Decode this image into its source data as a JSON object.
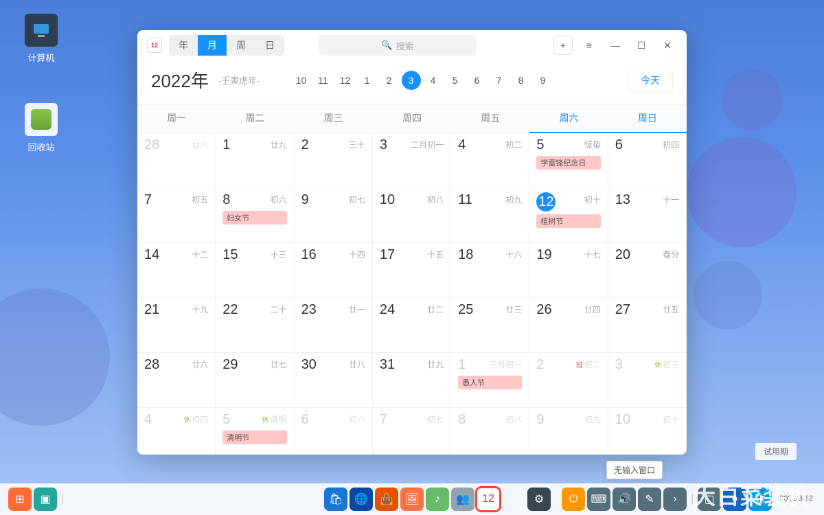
{
  "desktop": {
    "computer": "计算机",
    "trash": "回收站"
  },
  "window": {
    "appIconText": "12",
    "views": {
      "year": "年",
      "month": "月",
      "week": "周",
      "day": "日",
      "active": "月"
    },
    "searchPlaceholder": "搜索",
    "yearTitle": "2022年",
    "yearSub": "-壬寅虎年-",
    "monthValues": [
      "10",
      "11",
      "12",
      "1",
      "2",
      "3",
      "4",
      "5",
      "6",
      "7",
      "8",
      "9"
    ],
    "currentMonth": "3",
    "todayLabel": "今天",
    "weekdays": [
      "周一",
      "周二",
      "周三",
      "周四",
      "周五",
      "周六",
      "周日"
    ]
  },
  "cells": [
    [
      {
        "d": "28",
        "l": "廿八",
        "dim": true
      },
      {
        "d": "1",
        "l": "廿九"
      },
      {
        "d": "2",
        "l": "三十"
      },
      {
        "d": "3",
        "l": "二月初一"
      },
      {
        "d": "4",
        "l": "初二"
      },
      {
        "d": "5",
        "l": "惊蛰",
        "ev": "学雷锋纪念日"
      },
      {
        "d": "6",
        "l": "初四"
      }
    ],
    [
      {
        "d": "7",
        "l": "初五"
      },
      {
        "d": "8",
        "l": "初六",
        "ev": "妇女节"
      },
      {
        "d": "9",
        "l": "初七"
      },
      {
        "d": "10",
        "l": "初八"
      },
      {
        "d": "11",
        "l": "初九"
      },
      {
        "d": "12",
        "l": "初十",
        "today": true,
        "ev": "植树节"
      },
      {
        "d": "13",
        "l": "十一"
      }
    ],
    [
      {
        "d": "14",
        "l": "十二"
      },
      {
        "d": "15",
        "l": "十三"
      },
      {
        "d": "16",
        "l": "十四"
      },
      {
        "d": "17",
        "l": "十五"
      },
      {
        "d": "18",
        "l": "十六"
      },
      {
        "d": "19",
        "l": "十七"
      },
      {
        "d": "20",
        "l": "春分"
      }
    ],
    [
      {
        "d": "21",
        "l": "十九"
      },
      {
        "d": "22",
        "l": "二十"
      },
      {
        "d": "23",
        "l": "廿一"
      },
      {
        "d": "24",
        "l": "廿二"
      },
      {
        "d": "25",
        "l": "廿三"
      },
      {
        "d": "26",
        "l": "廿四"
      },
      {
        "d": "27",
        "l": "廿五"
      }
    ],
    [
      {
        "d": "28",
        "l": "廿六"
      },
      {
        "d": "29",
        "l": "廿七"
      },
      {
        "d": "30",
        "l": "廿八"
      },
      {
        "d": "31",
        "l": "廿九"
      },
      {
        "d": "1",
        "l": "三月初一",
        "dim": true,
        "ev": "愚人节"
      },
      {
        "d": "2",
        "l": "初二",
        "dim": true,
        "dot": "red"
      },
      {
        "d": "3",
        "l": "初三",
        "dim": true,
        "dot": "green"
      }
    ],
    [
      {
        "d": "4",
        "l": "初四",
        "dim": true,
        "dot": "green"
      },
      {
        "d": "5",
        "l": "清明",
        "dim": true,
        "ev": "清明节",
        "dot": "green"
      },
      {
        "d": "6",
        "l": "初六",
        "dim": true
      },
      {
        "d": "7",
        "l": "初七",
        "dim": true
      },
      {
        "d": "8",
        "l": "初八",
        "dim": true
      },
      {
        "d": "9",
        "l": "初九",
        "dim": true
      },
      {
        "d": "10",
        "l": "初十",
        "dim": true
      }
    ]
  ],
  "tooltip": "无输入窗口",
  "trial": "试用期",
  "taskbarDate": "2022/3/12",
  "watermark": "大白菜装机",
  "dockIcons": [
    {
      "name": "launcher-icon",
      "bg": "#ff6b35",
      "g": "⊞"
    },
    {
      "name": "file-manager-icon",
      "bg": "#26a69a",
      "g": "▣"
    },
    {
      "name": "divider",
      "bg": "transparent",
      "g": "|"
    },
    {
      "name": "app-store-icon",
      "bg": "#1976d2",
      "g": "🛍"
    },
    {
      "name": "browser-icon",
      "bg": "#0d47a1",
      "g": "🌐"
    },
    {
      "name": "bag-icon",
      "bg": "#e65100",
      "g": "👜"
    },
    {
      "name": "photos-icon",
      "bg": "#ff7043",
      "g": "🖼"
    },
    {
      "name": "music-icon",
      "bg": "#66bb6a",
      "g": "♪"
    },
    {
      "name": "contacts-icon",
      "bg": "#90a4ae",
      "g": "👥"
    },
    {
      "name": "calendar-icon",
      "bg": "#fff",
      "g": "12",
      "hl": true
    },
    {
      "name": "settings-icon",
      "bg": "#37474f",
      "g": "⚙"
    },
    {
      "name": "separator-icon",
      "bg": "transparent",
      "g": ""
    },
    {
      "name": "power-icon",
      "bg": "#ff9800",
      "g": "⏻"
    },
    {
      "name": "keyboard-icon",
      "bg": "#546e7a",
      "g": "⌨"
    },
    {
      "name": "volume-icon",
      "bg": "#546e7a",
      "g": "🔊"
    },
    {
      "name": "edit-icon",
      "bg": "#546e7a",
      "g": "✎"
    },
    {
      "name": "more-icon",
      "bg": "#546e7a",
      "g": "›"
    },
    {
      "name": "separator2-icon",
      "bg": "transparent",
      "g": "|"
    },
    {
      "name": "desktop-icon",
      "bg": "#546e7a",
      "g": "▢"
    },
    {
      "name": "globe-icon",
      "bg": "#1565c0",
      "g": "●"
    },
    {
      "name": "shield-icon",
      "bg": "#039be5",
      "g": "🛡"
    }
  ]
}
